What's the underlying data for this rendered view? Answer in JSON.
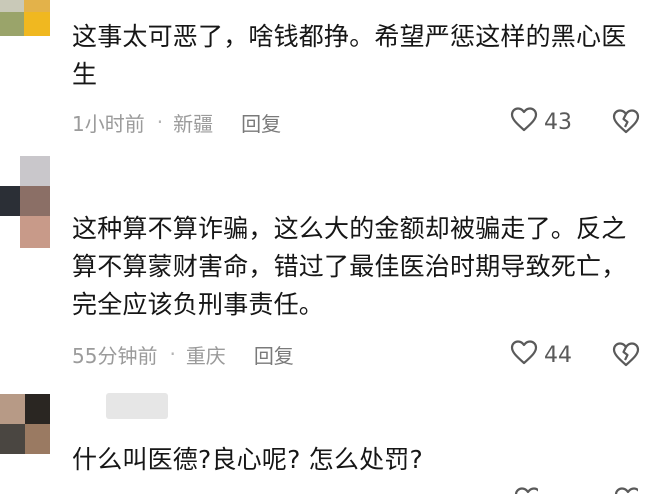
{
  "comments": [
    {
      "text": "这事太可恶了，啥钱都挣。希望严惩这样的黑心医生",
      "time": "1小时前",
      "location": "新疆",
      "reply_label": "回复",
      "likes": "43"
    },
    {
      "text": "这种算不算诈骗，这么大的金额却被骗走了。反之算不算蒙财害命，错过了最佳医治时期导致死亡，完全应该负刑事责任。",
      "time": "55分钟前",
      "location": "重庆",
      "reply_label": "回复",
      "likes": "44"
    },
    {
      "text": "什么叫医德?良心呢? 怎么处罚?"
    }
  ],
  "icons": {
    "like": "heart-outline-icon",
    "dislike": "broken-heart-icon"
  },
  "colors": {
    "text": "#161616",
    "meta": "#9b9b9b",
    "icon": "#5a5a5a"
  }
}
